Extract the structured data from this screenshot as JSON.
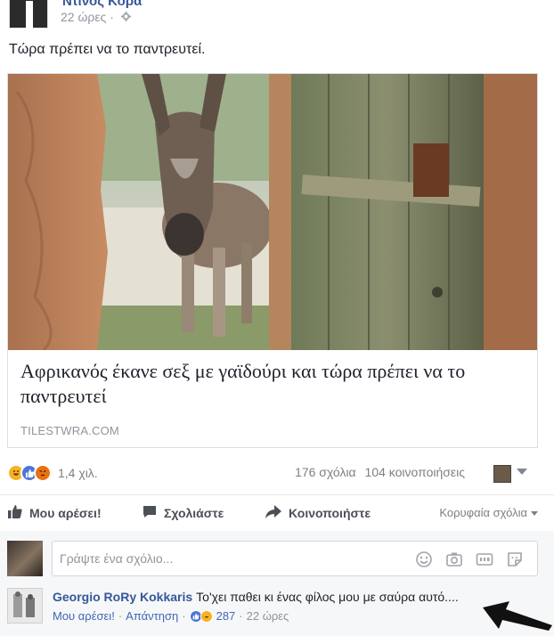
{
  "post": {
    "author": "Ντίνος Κορα",
    "time": "22 ώρες",
    "text": "Τώρα πρέπει να το παντρευτεί."
  },
  "link": {
    "title": "Αφρικανός έκανε σεξ με γαϊδούρι και τώρα πρέπει να το παντρευτεί",
    "domain": "TILESTWRA.COM"
  },
  "stats": {
    "reactions_count": "1,4 χιλ.",
    "comments": "176 σχόλια",
    "shares": "104 κοινοποιήσεις"
  },
  "actions": {
    "like": "Μου αρέσει!",
    "comment": "Σχολιάστε",
    "share": "Κοινοποιήστε",
    "top_comments": "Κορυφαία σχόλια"
  },
  "comment_box": {
    "placeholder": "Γράψτε ένα σχόλιο..."
  },
  "comment": {
    "author": "Georgio RoRy Kokkaris",
    "text": "Το'χει παθει κι ένας φίλος μου με σαύρα αυτό....",
    "like": "Μου αρέσει!",
    "reply": "Απάντηση",
    "reaction_count": "287",
    "time": "22 ώρες"
  },
  "colors": {
    "link_blue": "#365899",
    "like_blue": "#4a76d9",
    "haha_yellow": "#f7b125",
    "angry_orange": "#e9710f"
  },
  "icons": [
    "gear-icon",
    "haha-icon",
    "like-icon",
    "angry-icon",
    "thumbs-up-icon",
    "speech-bubble-icon",
    "share-arrow-icon",
    "emoji-icon",
    "camera-icon",
    "gif-icon",
    "sticker-icon",
    "arrow-icon"
  ]
}
